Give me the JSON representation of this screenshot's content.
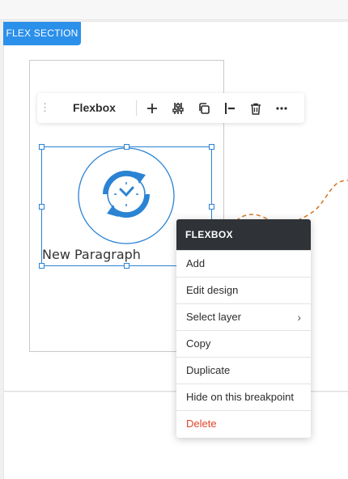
{
  "section": {
    "tag_label": "FLEX SECTION"
  },
  "toolbar": {
    "title": "Flexbox"
  },
  "content": {
    "paragraph": "New Paragraph"
  },
  "context_menu": {
    "header": "FLEXBOX",
    "items": [
      {
        "label": "Add"
      },
      {
        "label": "Edit design"
      },
      {
        "label": "Select layer"
      },
      {
        "label": "Copy"
      },
      {
        "label": "Duplicate"
      },
      {
        "label": "Hide on this breakpoint"
      },
      {
        "label": "Delete"
      }
    ]
  },
  "icons": {
    "toolbar": [
      "drag-handle-icon",
      "plus-icon",
      "sliders-icon",
      "copy-icon",
      "align-icon",
      "trash-icon",
      "more-icon"
    ],
    "content": "clock-refresh-icon",
    "submenu": "chevron-right-icon"
  },
  "colors": {
    "accent": "#2b90ea",
    "selection": "#2b83d3",
    "menu_header": "#2f3337",
    "delete": "#e0452c",
    "decoration": "#d57a2a"
  }
}
